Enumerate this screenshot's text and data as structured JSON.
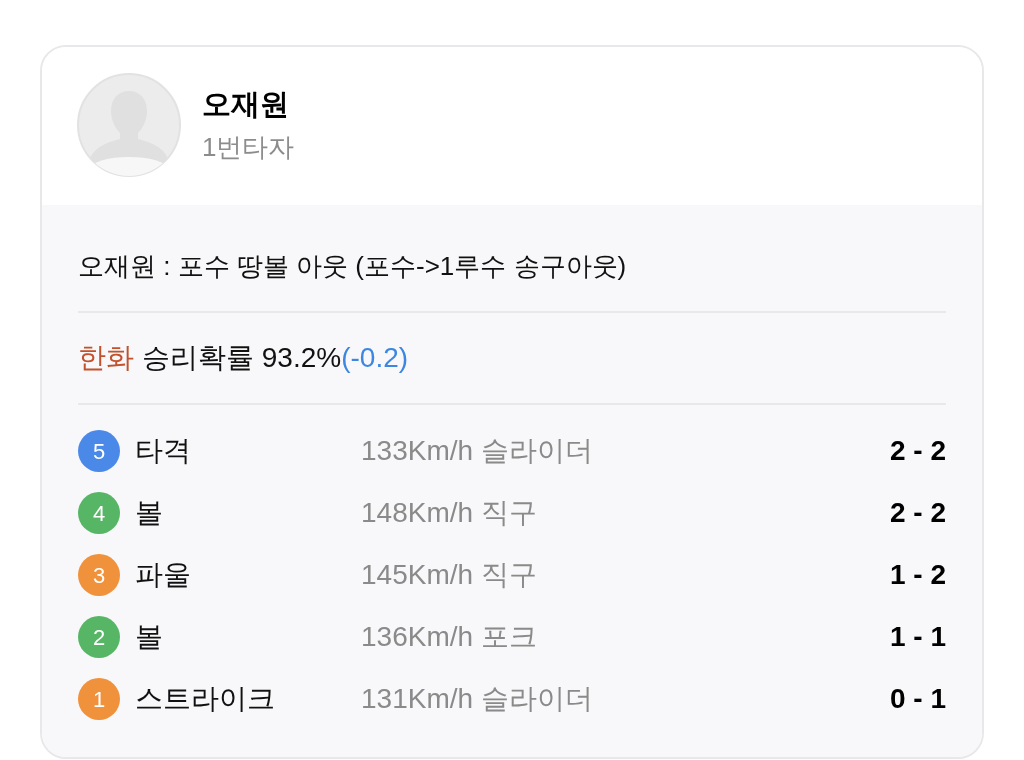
{
  "player": {
    "name": "오재원",
    "batting_order": "1번타자"
  },
  "play_result": "오재원 : 포수 땅볼 아웃 (포수->1루수 송구아웃)",
  "win_probability": {
    "team": "한화",
    "label": "승리확률 93.2%",
    "change": "(-0.2)"
  },
  "pitches": [
    {
      "number": "5",
      "color": "#4a89e8",
      "result": "타격",
      "pitch": "133Km/h 슬라이더",
      "count": "2 - 2"
    },
    {
      "number": "4",
      "color": "#57b566",
      "result": "볼",
      "pitch": "148Km/h 직구",
      "count": "2 - 2"
    },
    {
      "number": "3",
      "color": "#f0913b",
      "result": "파울",
      "pitch": "145Km/h 직구",
      "count": "1 - 2"
    },
    {
      "number": "2",
      "color": "#57b566",
      "result": "볼",
      "pitch": "136Km/h 포크",
      "count": "1 - 1"
    },
    {
      "number": "1",
      "color": "#f0913b",
      "result": "스트라이크",
      "pitch": "131Km/h 슬라이더",
      "count": "0 - 1"
    }
  ]
}
